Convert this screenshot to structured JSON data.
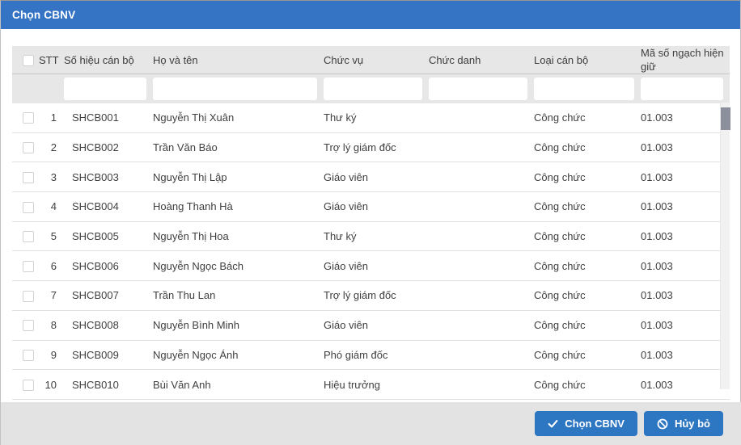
{
  "dialog": {
    "title": "Chọn CBNV"
  },
  "colors": {
    "titlebar_blue": "#3574c4",
    "button_blue": "#2d76c2",
    "table_header_gray": "#e7e7e7",
    "footer_gray": "#e3e3e3",
    "row_border": "#e0e0e0",
    "scroll_thumb": "#8b909c"
  },
  "table": {
    "select_all_checked": false,
    "columns": {
      "stt": "STT",
      "so_hieu": "Số hiệu cán bộ",
      "ho_ten": "Họ và tên",
      "chuc_vu": "Chức vụ",
      "chuc_danh": "Chức danh",
      "loai_can_bo": "Loại cán bộ",
      "ma_so_ngach": "Mã số ngạch hiện giữ"
    },
    "filter_values": {
      "so_hieu": "",
      "ho_ten": "",
      "chuc_vu": "",
      "chuc_danh": "",
      "loai_can_bo": "",
      "ma_so_ngach": ""
    },
    "rows": [
      {
        "stt": "1",
        "so_hieu": "SHCB001",
        "ho_ten": "Nguyễn Thị Xuân",
        "chuc_vu": "Thư ký",
        "chuc_danh": "",
        "loai_can_bo": "Công chức",
        "ma_so_ngach": "01.003",
        "checked": false
      },
      {
        "stt": "2",
        "so_hieu": "SHCB002",
        "ho_ten": "Trần Văn Báo",
        "chuc_vu": "Trợ lý giám đốc",
        "chuc_danh": "",
        "loai_can_bo": "Công chức",
        "ma_so_ngach": "01.003",
        "checked": false
      },
      {
        "stt": "3",
        "so_hieu": "SHCB003",
        "ho_ten": "Nguyễn Thị Lập",
        "chuc_vu": "Giáo viên",
        "chuc_danh": "",
        "loai_can_bo": "Công chức",
        "ma_so_ngach": "01.003",
        "checked": false
      },
      {
        "stt": "4",
        "so_hieu": "SHCB004",
        "ho_ten": "Hoàng Thanh Hà",
        "chuc_vu": "Giáo viên",
        "chuc_danh": "",
        "loai_can_bo": "Công chức",
        "ma_so_ngach": "01.003",
        "checked": false
      },
      {
        "stt": "5",
        "so_hieu": "SHCB005",
        "ho_ten": "Nguyễn Thị Hoa",
        "chuc_vu": "Thư ký",
        "chuc_danh": "",
        "loai_can_bo": "Công chức",
        "ma_so_ngach": "01.003",
        "checked": false
      },
      {
        "stt": "6",
        "so_hieu": "SHCB006",
        "ho_ten": "Nguyễn Ngọc Bách",
        "chuc_vu": "Giáo viên",
        "chuc_danh": "",
        "loai_can_bo": "Công chức",
        "ma_so_ngach": "01.003",
        "checked": false
      },
      {
        "stt": "7",
        "so_hieu": "SHCB007",
        "ho_ten": "Trần Thu Lan",
        "chuc_vu": "Trợ lý giám đốc",
        "chuc_danh": "",
        "loai_can_bo": "Công chức",
        "ma_so_ngach": "01.003",
        "checked": false
      },
      {
        "stt": "8",
        "so_hieu": "SHCB008",
        "ho_ten": "Nguyễn Bình Minh",
        "chuc_vu": "Giáo viên",
        "chuc_danh": "",
        "loai_can_bo": "Công chức",
        "ma_so_ngach": "01.003",
        "checked": false
      },
      {
        "stt": "9",
        "so_hieu": "SHCB009",
        "ho_ten": "Nguyễn Ngọc Ánh",
        "chuc_vu": "Phó giám đốc",
        "chuc_danh": "",
        "loai_can_bo": "Công chức",
        "ma_so_ngach": "01.003",
        "checked": false
      },
      {
        "stt": "10",
        "so_hieu": "SHCB010",
        "ho_ten": "Bùi Văn Anh",
        "chuc_vu": "Hiệu trưởng",
        "chuc_danh": "",
        "loai_can_bo": "Công chức",
        "ma_so_ngach": "01.003",
        "checked": false
      }
    ]
  },
  "footer": {
    "select_button_label": "Chọn CBNV",
    "cancel_button_label": "Hủy bỏ"
  }
}
